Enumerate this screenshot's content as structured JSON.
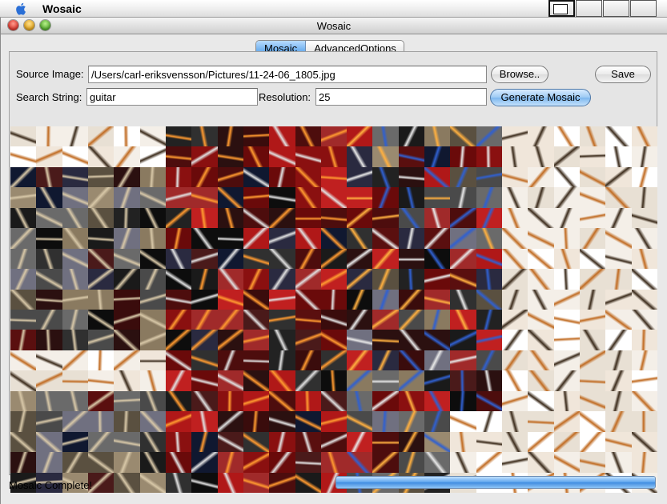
{
  "menubar": {
    "app_name": "Wosaic"
  },
  "window": {
    "title": "Wosaic"
  },
  "tabs": [
    {
      "label": "Mosaic",
      "active": true
    },
    {
      "label": "AdvancedOptions",
      "active": false
    }
  ],
  "form": {
    "source_label": "Source Image:",
    "source_value": "/Users/carl-eriksvensson/Pictures/11-24-06_1805.jpg",
    "browse_label": "Browse..",
    "save_label": "Save",
    "search_label": "Search String:",
    "search_value": "guitar",
    "resolution_label": "Resolution:",
    "resolution_value": "25",
    "generate_label": "Generate Mosaic"
  },
  "mosaic": {
    "columns": 25,
    "rows": 18
  },
  "status": {
    "text": "Mosaic Complete!",
    "progress": 1.0
  },
  "colors": {
    "accent": "#5aa3ec",
    "tab_active": "#8cc2f5"
  }
}
